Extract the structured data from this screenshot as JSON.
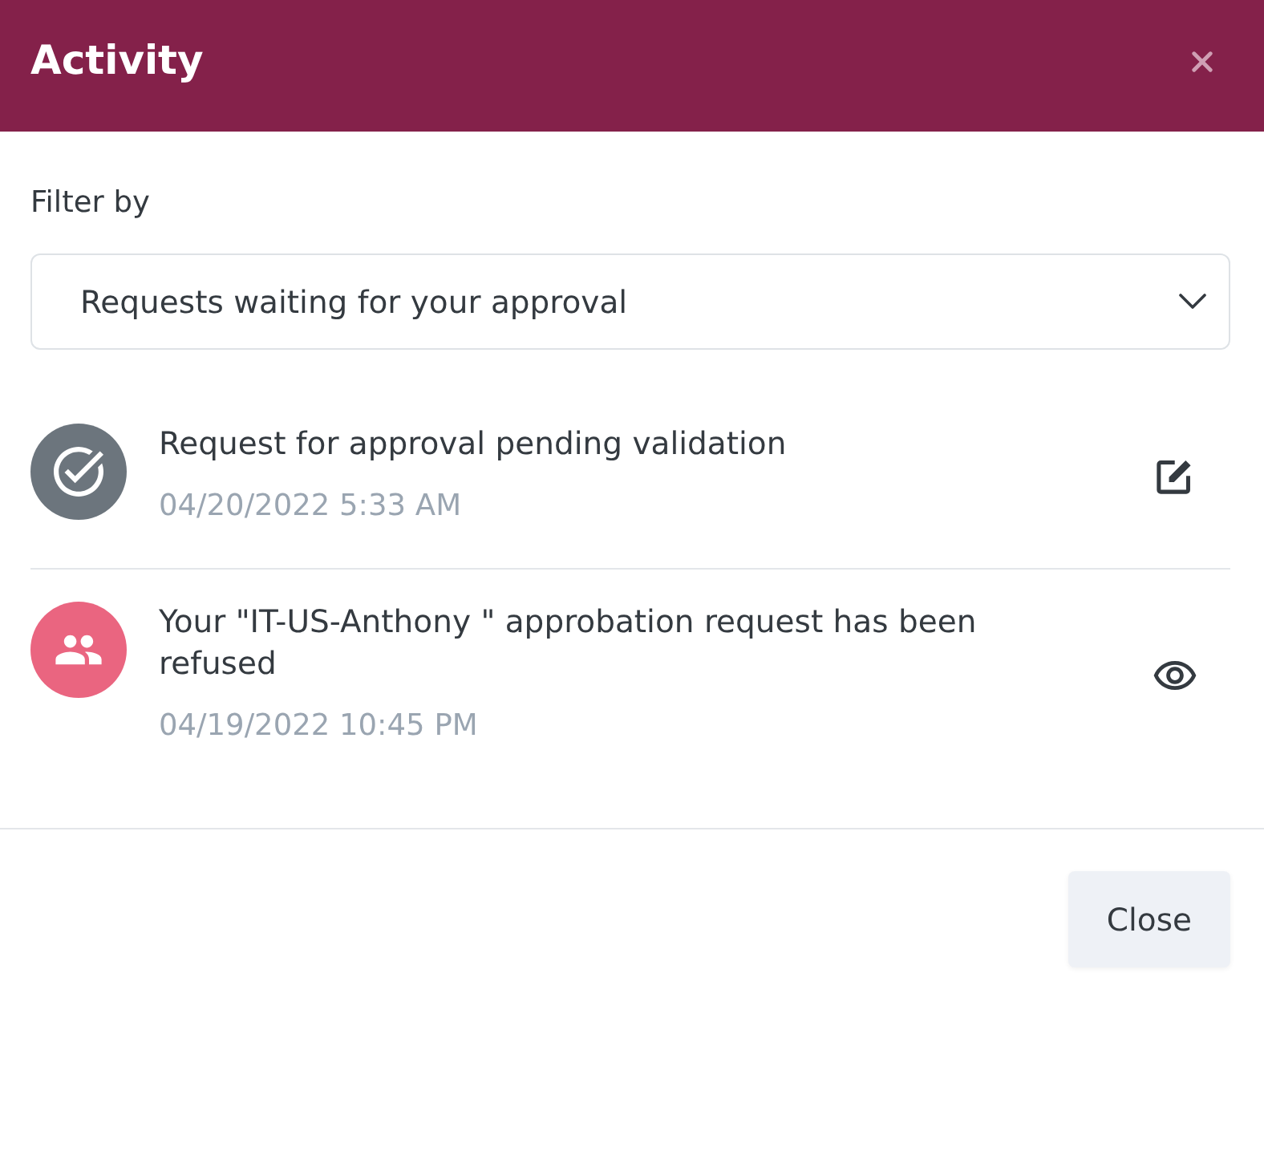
{
  "header": {
    "title": "Activity"
  },
  "filter": {
    "label": "Filter by",
    "value": "Requests waiting for your approval"
  },
  "items": [
    {
      "kind": "pending",
      "color": "#6c757d",
      "title": "Request for approval pending validation",
      "date": "04/20/2022 5:33 AM"
    },
    {
      "kind": "refused",
      "color": "#ea6580",
      "title": "Your \"IT-US-Anthony \" approbation request has been refused",
      "date": "04/19/2022 10:45 PM"
    }
  ],
  "footer": {
    "button": "Close"
  }
}
